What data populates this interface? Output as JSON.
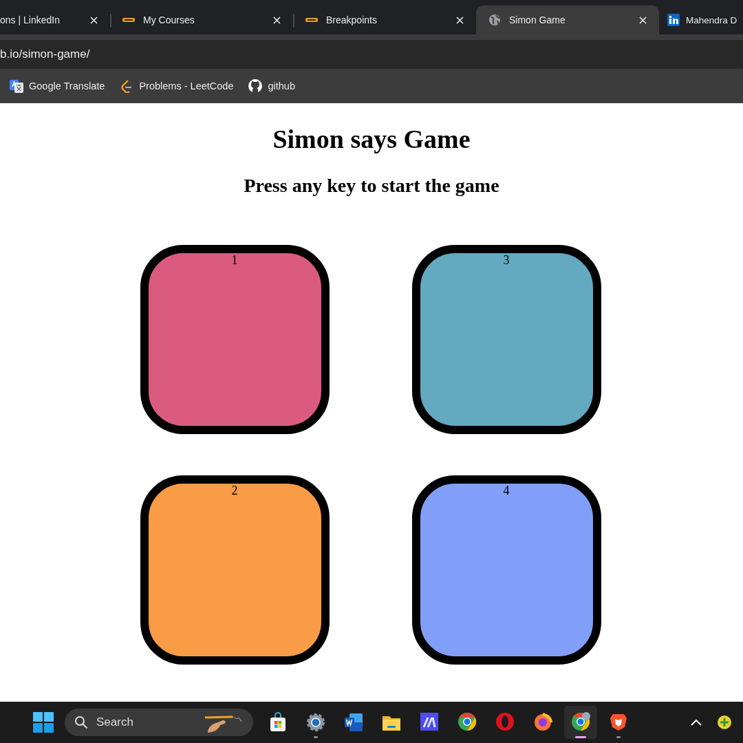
{
  "tabs": [
    {
      "label": "ons | LinkedIn",
      "kind": "none",
      "selected": false
    },
    {
      "label": "My Courses",
      "kind": "college",
      "selected": false
    },
    {
      "label": "Breakpoints",
      "kind": "college",
      "selected": false
    },
    {
      "label": "Simon Game",
      "kind": "globe",
      "selected": true
    },
    {
      "label": "Mahendra D",
      "kind": "linkedin",
      "selected": false
    }
  ],
  "address": "b.io/simon-game/",
  "bookmarks": [
    {
      "label": "Google Translate",
      "kind": "translate"
    },
    {
      "label": "Problems - LeetCode",
      "kind": "leetcode"
    },
    {
      "label": "github",
      "kind": "github"
    }
  ],
  "page": {
    "title": "Simon says Game",
    "subtitle": "Press any key to start the game",
    "buttons": [
      {
        "label": "1",
        "color": "#db5a80"
      },
      {
        "label": "3",
        "color": "#63a9c0"
      },
      {
        "label": "2",
        "color": "#f99c45"
      },
      {
        "label": "4",
        "color": "#819ff8"
      }
    ]
  },
  "taskbar": {
    "search": {
      "placeholder": "Search"
    },
    "apps": [
      {
        "kind": "store",
        "running": false,
        "selected": false
      },
      {
        "kind": "settings",
        "running": true,
        "selected": false
      },
      {
        "kind": "word",
        "running": false,
        "selected": false
      },
      {
        "kind": "folder",
        "running": false,
        "selected": false
      },
      {
        "kind": "ai",
        "running": false,
        "selected": false
      },
      {
        "kind": "chrome",
        "running": false,
        "selected": false
      },
      {
        "kind": "opera",
        "running": false,
        "selected": false
      },
      {
        "kind": "firefox",
        "running": false,
        "selected": false
      },
      {
        "kind": "chrome",
        "running": true,
        "selected": true
      },
      {
        "kind": "brave",
        "running": true,
        "selected": false
      }
    ]
  }
}
